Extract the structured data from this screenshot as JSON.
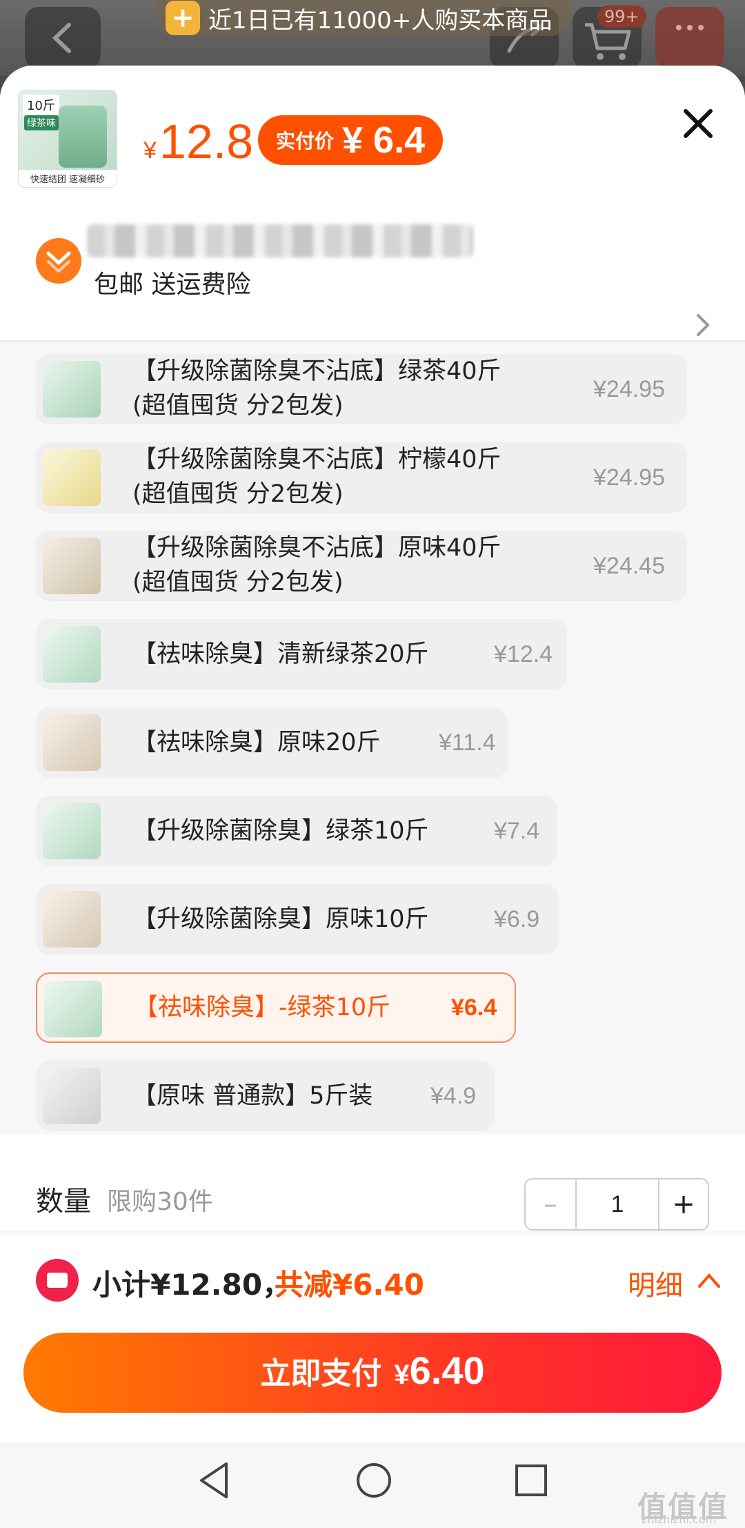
{
  "background": {
    "notice": "近1日已有11000+人购买本商品",
    "cart_badge": "99+"
  },
  "header": {
    "thumb_tag": "10斤",
    "thumb_tag2": "绿茶味",
    "thumb_footer": "快速结团 速凝细砂",
    "price_currency": "¥",
    "price": "12.8",
    "real_price_label": "实付价",
    "real_price": "¥ 6.4",
    "shipping": "包邮 送运费险"
  },
  "options": [
    {
      "name_line1": "【升级除菌除臭不沾底】绿茶40斤",
      "name_line2": "(超值囤货 分2包发)",
      "price": "¥24.95",
      "color": "#cfe6d8",
      "selected": false
    },
    {
      "name_line1": "【升级除菌除臭不沾底】柠檬40斤",
      "name_line2": "(超值囤货 分2包发)",
      "price": "¥24.95",
      "color": "#f3ecc0",
      "selected": false
    },
    {
      "name_line1": "【升级除菌除臭不沾底】原味40斤",
      "name_line2": "(超值囤货 分2包发)",
      "price": "¥24.45",
      "color": "#e6ded2",
      "selected": false
    },
    {
      "name_line1": "【祛味除臭】清新绿茶20斤",
      "name_line2": "",
      "price": "¥12.4",
      "color": "#d2e9dc",
      "selected": false
    },
    {
      "name_line1": "【祛味除臭】原味20斤",
      "name_line2": "",
      "price": "¥11.4",
      "color": "#e8ded0",
      "selected": false
    },
    {
      "name_line1": "【升级除菌除臭】绿茶10斤",
      "name_line2": "",
      "price": "¥7.4",
      "color": "#d2e9dc",
      "selected": false
    },
    {
      "name_line1": "【升级除菌除臭】原味10斤",
      "name_line2": "",
      "price": "¥6.9",
      "color": "#e8ded0",
      "selected": false
    },
    {
      "name_line1": "【祛味除臭】-绿茶10斤",
      "name_line2": "",
      "price": "¥6.4",
      "color": "#d2e9dc",
      "selected": true
    },
    {
      "name_line1": "【原味 普通款】5斤装",
      "name_line2": "",
      "price": "¥4.9",
      "color": "#e4e4e4",
      "selected": false
    }
  ],
  "quantity": {
    "label": "数量",
    "limit": "限购30件",
    "minus": "–",
    "value": "1",
    "plus": "+"
  },
  "footer": {
    "subtotal": "小计¥12.80，",
    "reduce": "共减¥6.40",
    "detail": "明细",
    "pay_label": "立即支付",
    "pay_currency": "¥",
    "pay_amount": "6.40"
  },
  "watermark": {
    "text": "值值值",
    "sub": "zhizhizhi.com"
  }
}
